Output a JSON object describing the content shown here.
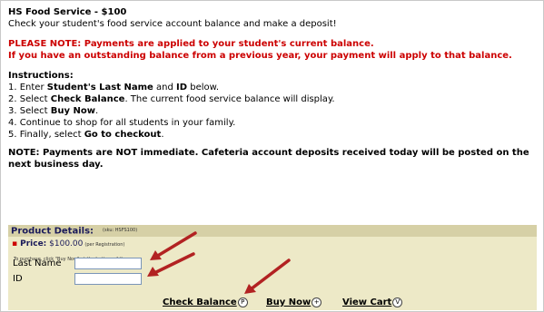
{
  "title": "HS Food Service - $100",
  "intro": "Check your student's food service account balance and make a deposit!",
  "notice": {
    "line1": "PLEASE NOTE: Payments are applied to your student's current balance.",
    "line2": "If you have an outstanding balance from a previous year, your payment will apply to that balance."
  },
  "instructions": {
    "heading": "Instructions:",
    "step1_pre": "1. Enter ",
    "step1_b1": "Student's Last Name",
    "step1_mid": " and ",
    "step1_b2": "ID",
    "step1_post": " below.",
    "step2_pre": "2. Select ",
    "step2_b": "Check Balance",
    "step2_post": ". The current food service balance will display.",
    "step3_pre": "3. Select ",
    "step3_b": "Buy Now",
    "step3_post": ".",
    "step4": "4. Continue to shop for all students in your family.",
    "step5_pre": "5. Finally, select ",
    "step5_b": "Go to checkout",
    "step5_post": "."
  },
  "note": "NOTE: Payments are NOT immediate. Cafeteria account deposits received today will be posted on the next business day.",
  "product": {
    "header": "Product Details:",
    "sku": "(sku: HSFS100)",
    "price_label": "Price:",
    "price_value": "$100.00",
    "price_unit": "(per Registration)",
    "purchase_note": "To purchase, click \"Buy Now\" at the bottom of the page."
  },
  "form": {
    "last_name_label": "Last Name",
    "id_label": "ID",
    "last_name_value": "",
    "id_value": ""
  },
  "actions": {
    "check_balance": "Check Balance",
    "check_balance_icon": "P",
    "buy_now": "Buy Now",
    "buy_now_icon": "+",
    "view_cart": "View Cart",
    "view_cart_icon": "V"
  },
  "colors": {
    "notice_red": "#cc0000",
    "product_bg": "#ede9c7",
    "arrow_red": "#b22222"
  }
}
